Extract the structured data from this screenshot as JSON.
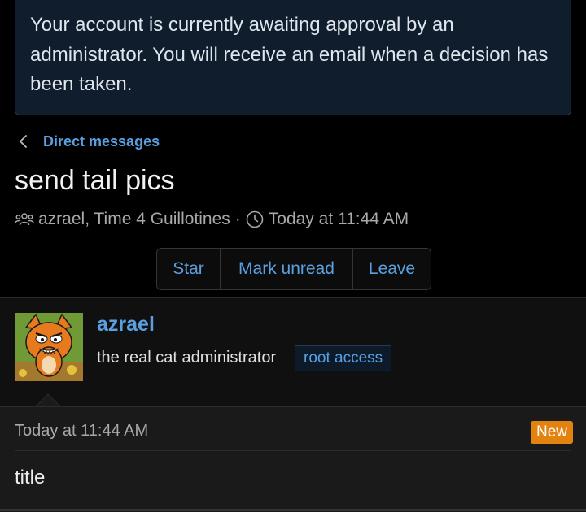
{
  "notice": {
    "text": "Your account is currently awaiting approval by an administrator. You will receive an email when a decision has been taken."
  },
  "breadcrumb": {
    "label": "Direct messages",
    "icon": "chevron-left-icon"
  },
  "conversation": {
    "title": "send tail pics",
    "participants": "azrael, Time 4 Guillotines",
    "separator": "·",
    "timestamp": "Today at 11:44 AM",
    "participants_icon": "users-icon",
    "time_icon": "clock-icon"
  },
  "actions": {
    "star": "Star",
    "mark_unread": "Mark unread",
    "leave": "Leave"
  },
  "author": {
    "name": "azrael",
    "user_title": "the real cat administrator",
    "banner": "root access"
  },
  "message": {
    "date": "Today at 11:44 AM",
    "badge": "New",
    "body": "title"
  },
  "colors": {
    "accent": "#5aa0e0",
    "background": "#000000",
    "badge": "#e3830f",
    "notice_bg": "#0f1d2c"
  }
}
